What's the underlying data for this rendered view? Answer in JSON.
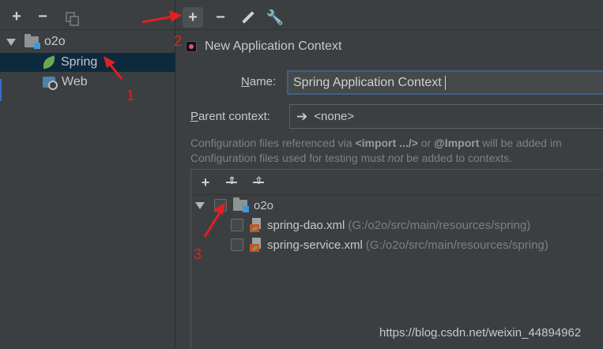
{
  "left_toolbar": {
    "add": "+",
    "remove": "−"
  },
  "left_tree": {
    "root": "o2o",
    "children": [
      {
        "label": "Spring",
        "icon": "spring-leaf-icon",
        "selected": true
      },
      {
        "label": "Web",
        "icon": "web-facet-icon",
        "selected": false
      }
    ]
  },
  "right_toolbar": {
    "add": "+",
    "remove": "−"
  },
  "context": {
    "title": "New Application Context",
    "name_label_pre": "",
    "name_label_u": "N",
    "name_label_post": "ame:",
    "name_value": "Spring Application Context",
    "parent_label_u": "P",
    "parent_label_post": "arent context:",
    "parent_value": "<none>",
    "info_line1_a": "Configuration files referenced via ",
    "info_line1_b": "<import .../>",
    "info_line1_c": " or ",
    "info_line1_d": "@Import",
    "info_line1_e": " will be added im",
    "info_line2_a": "Configuration files used for testing must ",
    "info_line2_b": "not",
    "info_line2_c": " be added to contexts."
  },
  "config_tree": {
    "root": "o2o",
    "files": [
      {
        "name": "spring-dao.xml",
        "path": "(G:/o2o/src/main/resources/spring)"
      },
      {
        "name": "spring-service.xml",
        "path": "(G:/o2o/src/main/resources/spring)"
      }
    ]
  },
  "annotations": {
    "n1": "1",
    "n2": "2",
    "n3": "3",
    "color": "#e02020"
  },
  "watermark": "https://blog.csdn.net/weixin_44894962"
}
